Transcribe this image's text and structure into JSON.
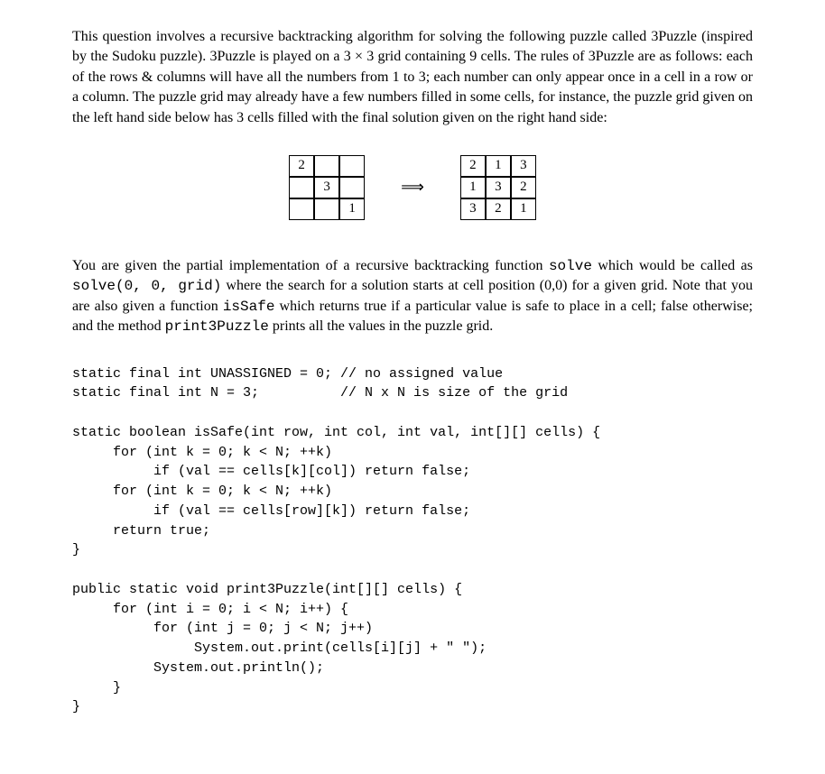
{
  "para1": {
    "t1": "This question involves a recursive backtracking algorithm for solving the following puzzle called 3Puzzle (inspired by the Sudoku puzzle). 3Puzzle is played on a 3 × 3 grid containing 9 cells. The rules of 3Puzzle are as follows: each of the rows & columns will have all the numbers from 1 to 3; each number can only appear once in a cell in a row or a column. The puzzle grid may already have a few numbers filled in some cells, for instance, the puzzle grid given on the left hand side below has 3 cells filled with the final solution given on the right hand side:"
  },
  "grid_left": [
    "2",
    "",
    "",
    "",
    "3",
    "",
    "",
    "",
    "1"
  ],
  "arrow": "⟹",
  "grid_right": [
    "2",
    "1",
    "3",
    "1",
    "3",
    "2",
    "3",
    "2",
    "1"
  ],
  "para2": {
    "t1": "You are given the partial implementation of a recursive backtracking function ",
    "c1": "solve",
    "t2": " which would be called as ",
    "c2": "solve(0, 0, grid)",
    "t3": " where the search for a solution starts at cell position (0,0) for a given grid. Note that you are also given a function ",
    "c3": "isSafe",
    "t4": " which returns true if a particular value is safe to place in a cell; false otherwise; and the method ",
    "c4": "print3Puzzle",
    "t5": " prints all the values in the puzzle grid."
  },
  "code": "static final int UNASSIGNED = 0; // no assigned value\nstatic final int N = 3;          // N x N is size of the grid\n\nstatic boolean isSafe(int row, int col, int val, int[][] cells) {\n     for (int k = 0; k < N; ++k)\n          if (val == cells[k][col]) return false;\n     for (int k = 0; k < N; ++k)\n          if (val == cells[row][k]) return false;\n     return true;\n}\n\npublic static void print3Puzzle(int[][] cells) {\n     for (int i = 0; i < N; i++) {\n          for (int j = 0; j < N; j++)\n               System.out.print(cells[i][j] + \" \");\n          System.out.println();\n     }\n}"
}
